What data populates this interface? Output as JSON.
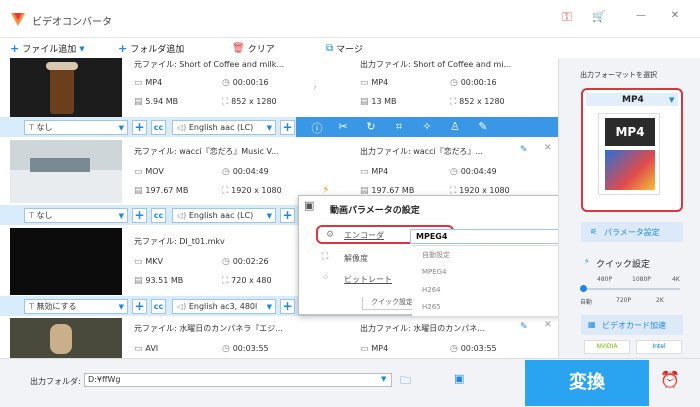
{
  "window": {
    "title": "ビデオコンバータ",
    "btn_key": "⚿",
    "btn_cart": "🛒",
    "btn_min": "—",
    "btn_close": "✕"
  },
  "toolbar": {
    "add_file": "ファイル追加",
    "add_folder": "フォルダ追加",
    "clear": "クリア",
    "merge": "マージ"
  },
  "rows": [
    {
      "src_name": "元ファイル: Short of Coffee and milk...",
      "src_format": "MP4",
      "src_duration": "00:00:16",
      "src_size": "5.94 MB",
      "src_res": "852 x 1280",
      "out_name": "出力ファイル: Short of Coffee and mi...",
      "out_format": "MP4",
      "out_duration": "00:00:16",
      "out_size": "13 MB",
      "out_res": "852 x 1280",
      "subtitle": "なし",
      "audio": "English aac (LC)"
    },
    {
      "src_name": "元ファイル: wacci『恋だろ』Music V...",
      "src_format": "MOV",
      "src_duration": "00:04:49",
      "src_size": "197.67 MB",
      "src_res": "1920 x 1080",
      "out_name": "出力ファイル: wacci『恋だろ』...",
      "out_format": "MP4",
      "out_duration": "00:04:49",
      "out_size": "197.67 MB",
      "out_res": "1920 x 1080",
      "subtitle": "なし",
      "audio": "English aac (LC)"
    },
    {
      "src_name": "元ファイル: DI_t01.mkv",
      "src_format": "MKV",
      "src_duration": "00:02:26",
      "src_size": "93.51 MB",
      "src_res": "720 x 480",
      "subtitle": "無効にする",
      "audio": "English ac3, 480l"
    },
    {
      "src_name": "元ファイル: 水曜日のカンパネラ『エジ...",
      "src_format": "AVI",
      "src_duration": "00:03:55",
      "out_name": "出力ファイル: 水曜日のカンパネ...",
      "out_format": "MP4",
      "out_duration": "00:03:55"
    }
  ],
  "popup": {
    "title": "動画パラメータの設定",
    "encoder_label": "エンコーダ",
    "encoder_value": "MPEG4",
    "resolution_label": "解像度",
    "bitrate_label": "ビットレート",
    "quick_label": "クイック設定",
    "options": [
      "自動設定",
      "MPEG4",
      "H264",
      "H265"
    ]
  },
  "right_panel": {
    "output_format_label": "出力フォーマットを選択",
    "format_name": "MP4",
    "format_badge": "MP4",
    "param_button": "パラメータ設定",
    "quick_settings": "クイック設定",
    "quality_top": [
      "480P",
      "1080P",
      "4K"
    ],
    "quality_bottom": [
      "自動",
      "720P",
      "2K"
    ],
    "gpu_label": "ビデオカード加速",
    "gpu_brands": [
      "NVIDIA",
      "Intel"
    ]
  },
  "bottom": {
    "output_folder_label": "出力フォルダ:",
    "output_path": "D:¥ffWg",
    "convert_button": "変換"
  },
  "colors": {
    "accent": "#1e88e5",
    "convert": "#2aa3f0",
    "highlight": "#d9363e"
  }
}
